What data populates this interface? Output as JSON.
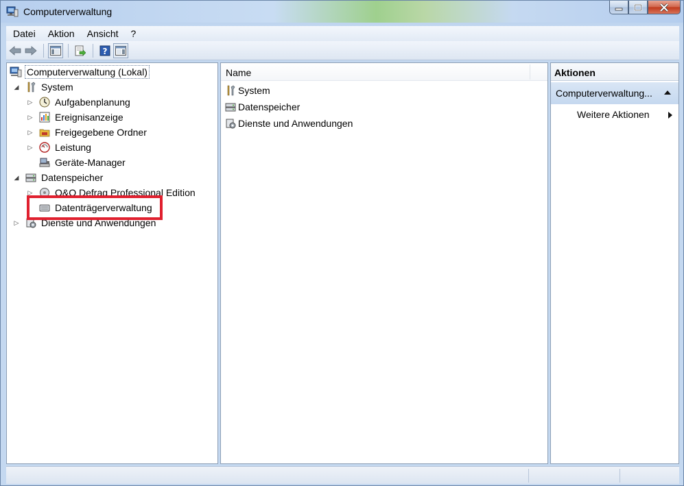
{
  "window": {
    "title": "Computerverwaltung"
  },
  "menu": [
    "Datei",
    "Aktion",
    "Ansicht",
    "?"
  ],
  "tree": {
    "root": "Computerverwaltung (Lokal)",
    "system": "System",
    "aufgabenplanung": "Aufgabenplanung",
    "ereignisanzeige": "Ereignisanzeige",
    "freigegebene_ordner": "Freigegebene Ordner",
    "leistung": "Leistung",
    "geraete_manager": "Geräte-Manager",
    "datenspeicher": "Datenspeicher",
    "oo_defrag": "O&O Defrag Professional Edition",
    "datentraegerverwaltung": "Datenträgerverwaltung",
    "dienste": "Dienste und Anwendungen"
  },
  "list": {
    "column_name": "Name",
    "items": [
      "System",
      "Datenspeicher",
      "Dienste und Anwendungen"
    ]
  },
  "actions": {
    "header": "Aktionen",
    "section": "Computerverwaltung...",
    "more": "Weitere Aktionen"
  },
  "colors": {
    "highlight": "#e0202f",
    "selection_bg": "#c5d8ef"
  }
}
